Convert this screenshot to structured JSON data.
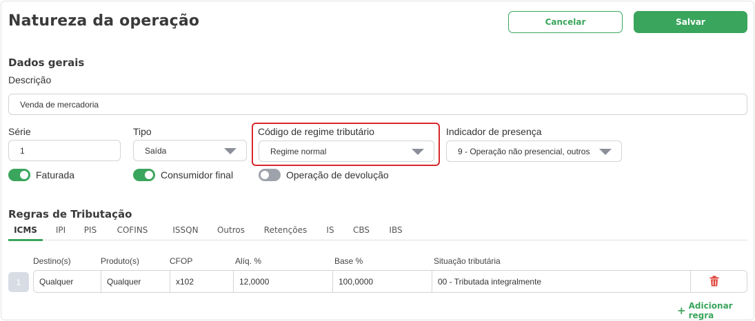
{
  "header": {
    "title": "Natureza da operação",
    "cancel_label": "Cancelar",
    "save_label": "Salvar"
  },
  "colors": {
    "accent": "#3aa55c",
    "highlight_border": "#d8262b",
    "delete_icon": "#e0453a"
  },
  "general": {
    "section_title": "Dados gerais",
    "description_label": "Descrição",
    "description_value": "Venda de mercadoria",
    "serie_label": "Série",
    "serie_value": "1",
    "tipo_label": "Tipo",
    "tipo_value": "Saída",
    "crt_label": "Código de regime tributário",
    "crt_value": "Regime normal",
    "presenca_label": "Indicador de presença",
    "presenca_value": "9 - Operação não presencial, outros",
    "toggles": [
      {
        "label": "Faturada",
        "on": true
      },
      {
        "label": "Consumidor final",
        "on": true
      },
      {
        "label": "Operação de devolução",
        "on": false
      }
    ]
  },
  "rules": {
    "section_title": "Regras de Tributação",
    "tabs": [
      {
        "label": "ICMS",
        "active": true
      },
      {
        "label": "IPI",
        "active": false
      },
      {
        "label": "PIS",
        "active": false
      },
      {
        "label": "COFINS",
        "active": false
      },
      {
        "label": "ISSQN",
        "active": false
      },
      {
        "label": "Outros",
        "active": false
      },
      {
        "label": "Retenções",
        "active": false
      },
      {
        "label": "IS",
        "active": false
      },
      {
        "label": "CBS",
        "active": false
      },
      {
        "label": "IBS",
        "active": false
      }
    ],
    "columns": [
      "Destino(s)",
      "Produto(s)",
      "CFOP",
      "Alíq. %",
      "Base %",
      "Situação tributária"
    ],
    "rows": [
      {
        "index": "1",
        "destino": "Qualquer",
        "produto": "Qualquer",
        "cfop": "x102",
        "aliq": "12,0000",
        "base": "100,0000",
        "situacao": "00 - Tributada integralmente"
      }
    ],
    "add_label": "Adicionar regra",
    "delete_icon": "trash-icon"
  }
}
